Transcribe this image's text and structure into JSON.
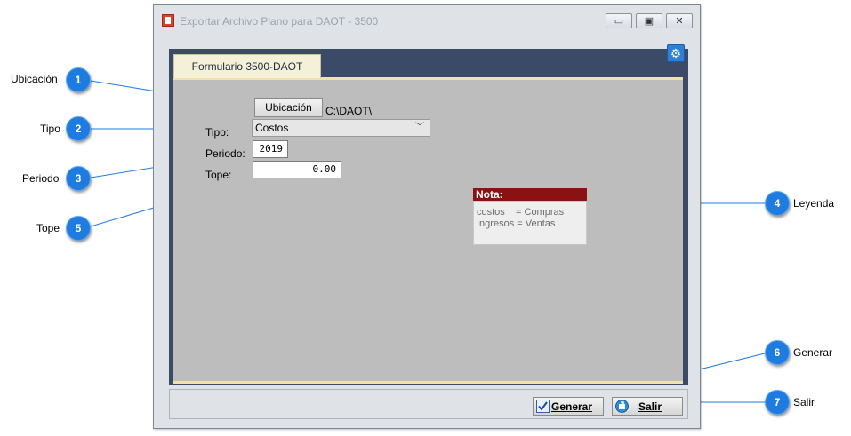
{
  "window": {
    "title": "Exportar Archivo Plano para DAOT - 3500",
    "minimize_glyph": "▭",
    "maximize_glyph": "▣",
    "close_glyph": "✕"
  },
  "tabs": [
    {
      "label": "Formulario 3500-DAOT"
    }
  ],
  "form": {
    "ubicacion_button": "Ubicación",
    "ubicacion_path": "C:\\DAOT\\",
    "tipo_label": "Tipo:",
    "tipo_value": "Costos",
    "periodo_label": "Periodo:",
    "periodo_value": "2019",
    "tope_label": "Tope:",
    "tope_value": "0.00"
  },
  "note": {
    "title": "Nota:",
    "line1": "costos    = Compras",
    "line2": "Ingresos = Ventas"
  },
  "buttons": {
    "generar": "Generar",
    "salir": "Salir"
  },
  "callouts": [
    {
      "num": "1",
      "label": "Ubicación"
    },
    {
      "num": "2",
      "label": "Tipo"
    },
    {
      "num": "3",
      "label": "Periodo"
    },
    {
      "num": "4",
      "label": "Leyenda"
    },
    {
      "num": "5",
      "label": "Tope"
    },
    {
      "num": "6",
      "label": "Generar"
    },
    {
      "num": "7",
      "label": "Salir"
    }
  ],
  "colors": {
    "callout": "#1e7be0",
    "tab_frame": "#3b4a66",
    "note_header": "#8b1212",
    "panel": "#bdbdbd"
  }
}
